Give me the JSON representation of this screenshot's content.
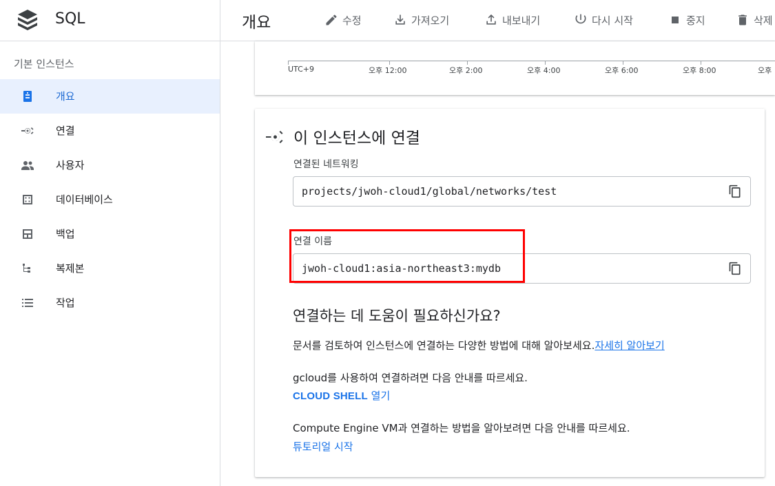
{
  "app": {
    "name": "SQL",
    "page_title": "개요"
  },
  "toolbar": {
    "edit": "수정",
    "import": "가져오기",
    "export": "내보내기",
    "restart": "다시 시작",
    "stop": "중지",
    "delete": "삭제"
  },
  "sidebar": {
    "section_title": "기본 인스턴스",
    "items": [
      {
        "label": "개요"
      },
      {
        "label": "연결"
      },
      {
        "label": "사용자"
      },
      {
        "label": "데이터베이스"
      },
      {
        "label": "백업"
      },
      {
        "label": "복제본"
      },
      {
        "label": "작업"
      }
    ]
  },
  "timeline": {
    "labels": [
      "UTC+9",
      "오후 12:00",
      "오후 2:00",
      "오후 4:00",
      "오후 6:00",
      "오후 8:00",
      "오후"
    ]
  },
  "connect": {
    "title": "이 인스턴스에 연결",
    "network_label": "연결된 네트워킹",
    "network_value": "projects/jwoh-cloud1/global/networks/test",
    "connection_name_label": "연결 이름",
    "connection_name_value": "jwoh-cloud1:asia-northeast3:mydb",
    "help_title": "연결하는 데 도움이 필요하신가요?",
    "docs_text": "문서를 검토하여 인스턴스에 연결하는 다양한 방법에 대해 알아보세요.",
    "docs_link": "자세히 알아보기",
    "gcloud_text": "gcloud를 사용하여 연결하려면 다음 안내를 따르세요.",
    "cloud_shell_link_strong": "CLOUD SHELL",
    "cloud_shell_link_rest": " 열기",
    "vm_text": "Compute Engine VM과 연결하는 방법을 알아보려면 다음 안내를 따르세요.",
    "tutorial_link": "튜토리얼 시작"
  },
  "icons": {
    "brand": "sql-stack-icon",
    "edit": "pencil-icon",
    "import": "import-icon",
    "export": "export-icon",
    "restart": "power-icon",
    "stop": "stop-icon",
    "delete": "trash-icon",
    "copy": "copy-icon"
  },
  "colors": {
    "accent": "#1a73e8",
    "active_bg": "#e8f0fe",
    "highlight": "#ff0000"
  }
}
